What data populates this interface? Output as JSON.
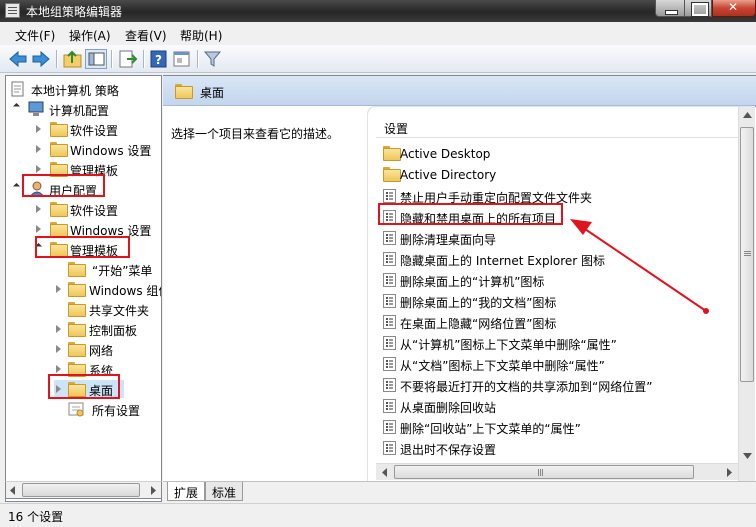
{
  "window": {
    "title": "本地组策略编辑器"
  },
  "menu": [
    "文件(F)",
    "操作(A)",
    "查看(V)",
    "帮助(H)"
  ],
  "toolbar": [
    "back-icon",
    "forward-icon",
    "up-folder-icon",
    "show-hide-tree-icon",
    "export-list-icon",
    "help-icon",
    "properties-icon",
    "filter-icon"
  ],
  "tree": {
    "root": "本地计算机 策略",
    "computer_config": "计算机配置",
    "cc_software": "软件设置",
    "cc_windows": "Windows 设置",
    "cc_admin": "管理模板",
    "user_config": "用户配置",
    "uc_software": "软件设置",
    "uc_windows": "Windows 设置",
    "uc_admin": "管理模板",
    "start_menu": "“开始”菜单",
    "windows_components": "Windows 组件",
    "shared_folders": "共享文件夹",
    "control_panel": "控制面板",
    "network": "网络",
    "system": "系统",
    "desktop": "桌面",
    "all_settings": "所有设置"
  },
  "detail": {
    "header": "桌面",
    "description": "选择一个项目来查看它的描述。",
    "column": "设置",
    "items": [
      {
        "label": "Active Desktop",
        "type": "folder"
      },
      {
        "label": "Active Directory",
        "type": "folder"
      },
      {
        "label": "禁止用户手动重定向配置文件文件夹",
        "type": "policy"
      },
      {
        "label": "隐藏和禁用桌面上的所有项目",
        "type": "policy"
      },
      {
        "label": "删除清理桌面向导",
        "type": "policy"
      },
      {
        "label": "隐藏桌面上的 Internet Explorer 图标",
        "type": "policy"
      },
      {
        "label": "删除桌面上的“计算机”图标",
        "type": "policy"
      },
      {
        "label": "删除桌面上的“我的文档”图标",
        "type": "policy"
      },
      {
        "label": "在桌面上隐藏“网络位置”图标",
        "type": "policy"
      },
      {
        "label": "从“计算机”图标上下文菜单中删除“属性”",
        "type": "policy"
      },
      {
        "label": "从“文档”图标上下文菜单中删除“属性”",
        "type": "policy"
      },
      {
        "label": "不要将最近打开的文档的共享添加到“网络位置”",
        "type": "policy"
      },
      {
        "label": "从桌面删除回收站",
        "type": "policy"
      },
      {
        "label": "删除“回收站”上下文菜单的“属性”",
        "type": "policy"
      },
      {
        "label": "退出时不保存设置",
        "type": "policy"
      }
    ]
  },
  "tabs": {
    "extended": "扩展",
    "standard": "标准"
  },
  "status": "16 个设置",
  "colors": {
    "highlight_red": "#e0141e",
    "header_blue": "#c3d6ee"
  }
}
